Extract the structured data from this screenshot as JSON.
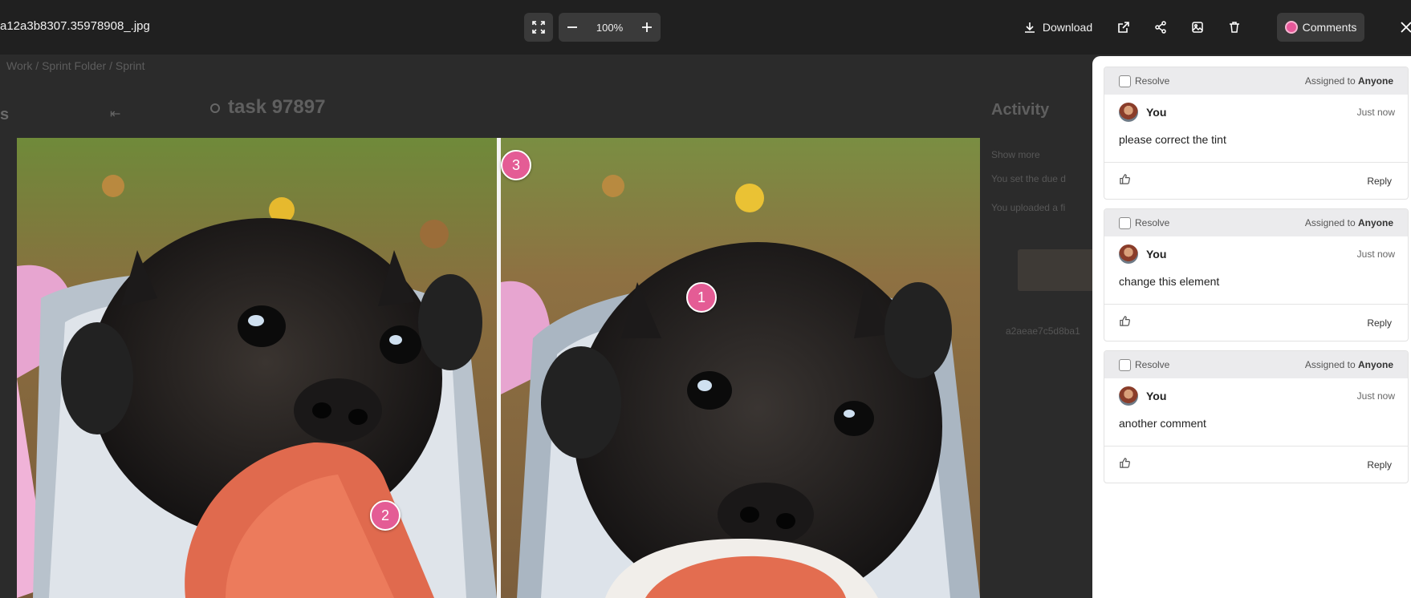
{
  "toolbar": {
    "filename": "a12a3b8307.35978908_.jpg",
    "zoom": "100%",
    "download_label": "Download",
    "comments_label": "Comments"
  },
  "background": {
    "breadcrumb": "Work  /  Sprint Folder  /  Sprint",
    "side_fragment": "s",
    "task_title": "task 97897",
    "activity_title": "Activity",
    "activity_lines": [
      "Show more",
      "You set the due d",
      "You uploaded a fi"
    ],
    "hash_fragment": "a2aeae7c5d8ba1"
  },
  "markers": [
    "1",
    "2",
    "3"
  ],
  "comments": [
    {
      "resolve_label": "Resolve",
      "assigned_prefix": "Assigned to",
      "assignee": "Anyone",
      "user": "You",
      "time": "Just now",
      "text": "please correct the tint",
      "reply_label": "Reply"
    },
    {
      "resolve_label": "Resolve",
      "assigned_prefix": "Assigned to",
      "assignee": "Anyone",
      "user": "You",
      "time": "Just now",
      "text": "change this element",
      "reply_label": "Reply"
    },
    {
      "resolve_label": "Resolve",
      "assigned_prefix": "Assigned to",
      "assignee": "Anyone",
      "user": "You",
      "time": "Just now",
      "text": "another comment",
      "reply_label": "Reply"
    }
  ],
  "colors": {
    "marker": "#e45c95",
    "toolbar_bg": "#202020",
    "panel_bg": "#ffffff"
  }
}
